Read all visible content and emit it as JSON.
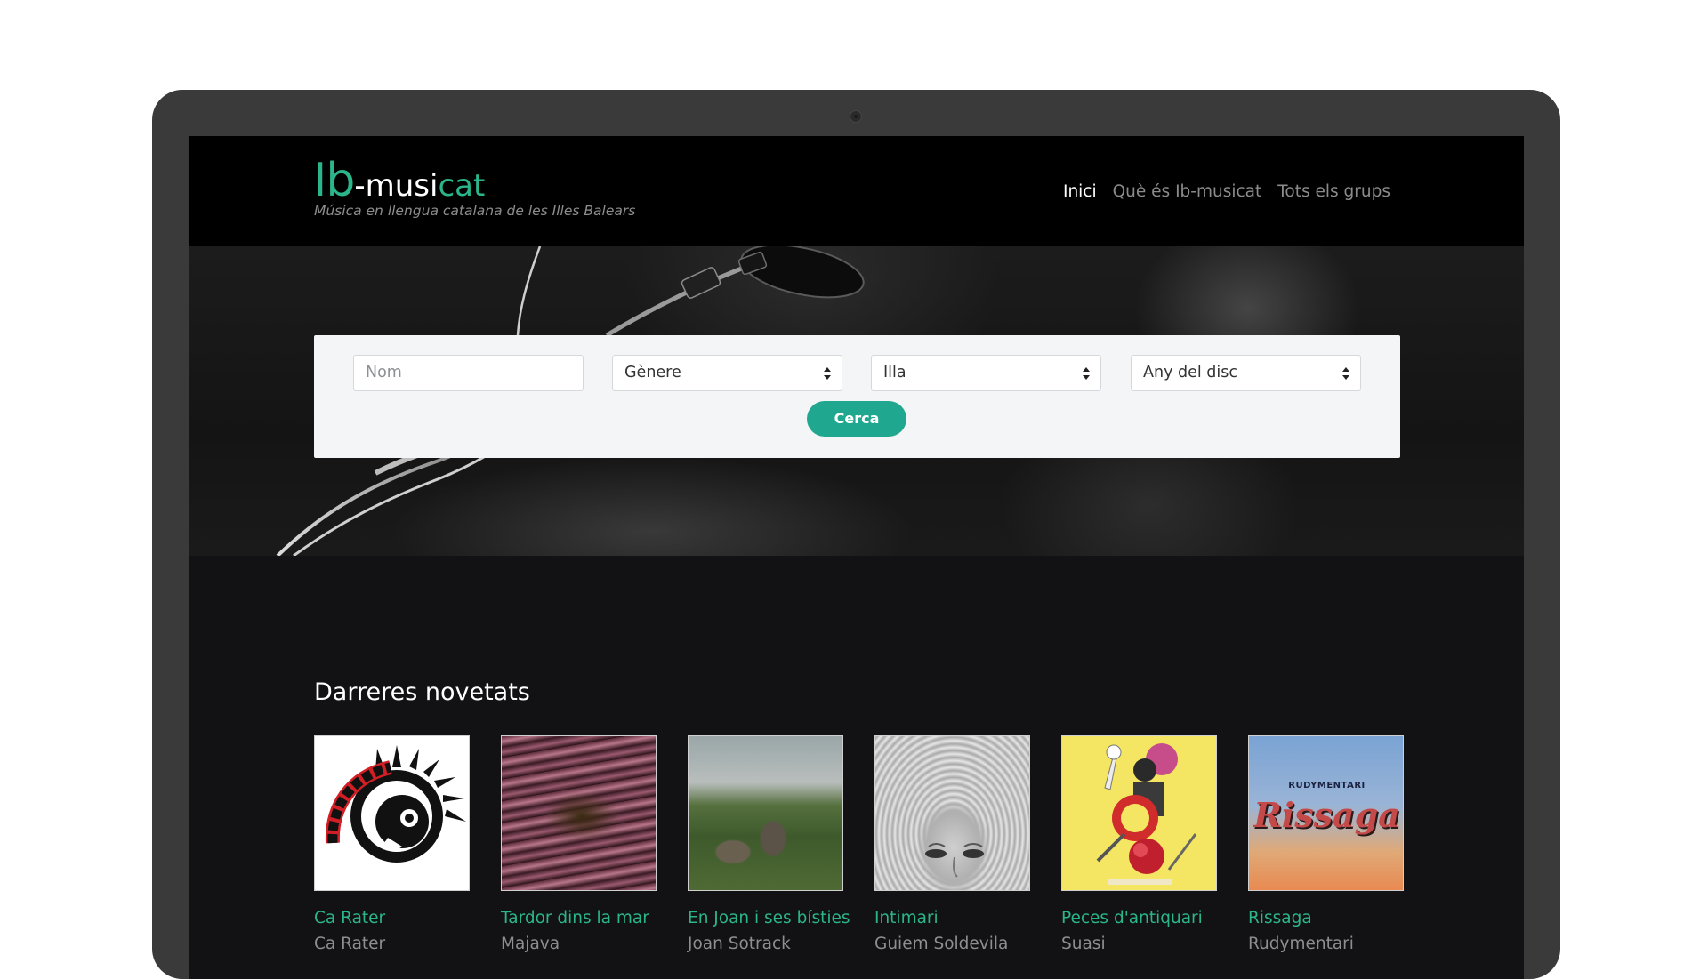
{
  "brand": {
    "logo_lb": "Ib",
    "logo_musi": "-musi",
    "logo_cat": "cat",
    "tagline": "Música en llengua catalana de les Illes Balears",
    "accent_color": "#2bb58a"
  },
  "nav": {
    "items": [
      {
        "label": "Inici",
        "active": true
      },
      {
        "label": "Què és Ib-musicat",
        "active": false
      },
      {
        "label": "Tots els grups",
        "active": false
      }
    ]
  },
  "search": {
    "name_placeholder": "Nom",
    "genre_value": "Gènere",
    "island_value": "Illa",
    "year_value": "Any del disc",
    "submit_label": "Cerca",
    "button_color": "#1fa88f"
  },
  "news": {
    "heading": "Darreres novetats",
    "albums": [
      {
        "title": "Ca Rater",
        "artist": "Ca Rater"
      },
      {
        "title": "Tardor dins la mar",
        "artist": "Majava"
      },
      {
        "title": "En Joan i ses bísties",
        "artist": "Joan Sotrack"
      },
      {
        "title": "Intimari",
        "artist": "Guiem Soldevila"
      },
      {
        "title": "Peces d'antiquari",
        "artist": "Suasi"
      },
      {
        "title": "Rissaga",
        "artist": "Rudymentari"
      }
    ],
    "cover_texts": {
      "rissaga_band": "RUDYMENTARI",
      "rissaga_word": "Rissaga"
    }
  }
}
